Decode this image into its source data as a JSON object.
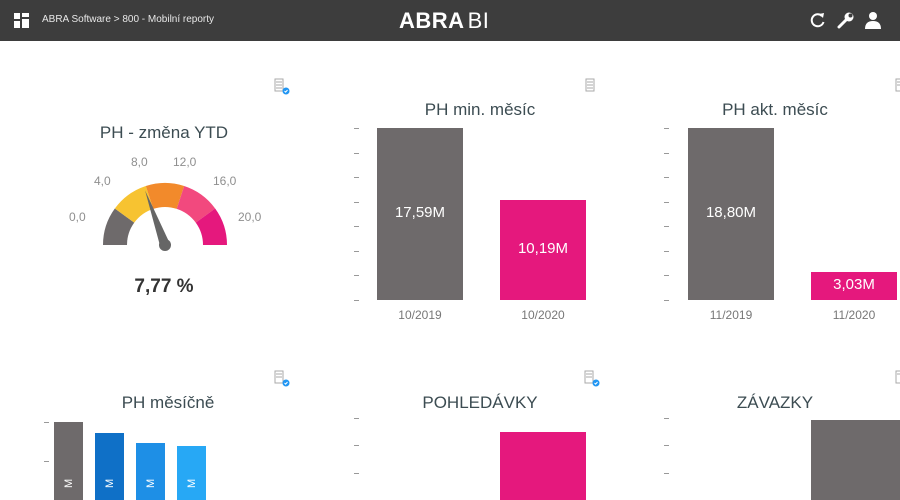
{
  "header": {
    "breadcrumb": "ABRA Software > 800 - Mobilní reporty",
    "brand_bold": "ABRA",
    "brand_light": "BI",
    "icons": [
      "dashboard-grid-icon",
      "refresh-icon",
      "wrench-icon",
      "user-icon"
    ]
  },
  "colors": {
    "topbar": "#3d3d3d",
    "gray_bar": "#6e6a6b",
    "pink_bar": "#e5187d",
    "blue_dark": "#0f70c7",
    "blue_mid": "#1e8fe6",
    "blue_light": "#27a8f5"
  },
  "tiles": {
    "ytd": {
      "title": "PH - změna YTD",
      "value_text": "7,77 %",
      "scale_labels": [
        "0,0",
        "4,0",
        "8,0",
        "12,0",
        "16,0",
        "20,0"
      ]
    },
    "prev_month": {
      "title": "PH min. měsíc"
    },
    "cur_month": {
      "title": "PH akt. měsíc"
    },
    "monthly": {
      "title": "PH měsíčně"
    },
    "receivables": {
      "title": "POHLEDÁVKY"
    },
    "payables": {
      "title": "ZÁVAZKY"
    }
  },
  "chart_data": [
    {
      "type": "gauge",
      "title": "PH - změna YTD",
      "value": 7.77,
      "value_label": "7,77 %",
      "range": [
        0,
        20
      ],
      "tick_labels": [
        "0,0",
        "4,0",
        "8,0",
        "12,0",
        "16,0",
        "20,0"
      ],
      "bands": [
        {
          "from": 0,
          "to": 4,
          "color": "#6e6a6b"
        },
        {
          "from": 4,
          "to": 8,
          "color": "#f7c331"
        },
        {
          "from": 8,
          "to": 12,
          "color": "#f28a2b"
        },
        {
          "from": 12,
          "to": 16,
          "color": "#f2497e"
        },
        {
          "from": 16,
          "to": 20,
          "color": "#e5187d"
        }
      ]
    },
    {
      "type": "bar",
      "title": "PH min. měsíc",
      "categories": [
        "10/2019",
        "10/2020"
      ],
      "values": [
        17.59,
        10.19
      ],
      "value_labels": [
        "17,59M",
        "10,19M"
      ],
      "colors": [
        "#6e6a6b",
        "#e5187d"
      ],
      "ylim": [
        0,
        17.59
      ]
    },
    {
      "type": "bar",
      "title": "PH akt. měsíc",
      "categories": [
        "11/2019",
        "11/2020"
      ],
      "values": [
        18.8,
        3.03
      ],
      "value_labels": [
        "18,80M",
        "3,03M"
      ],
      "colors": [
        "#6e6a6b",
        "#e5187d"
      ],
      "ylim": [
        0,
        20.7
      ]
    },
    {
      "type": "bar",
      "title": "PH měsíčně",
      "values": [
        1.0,
        0.86,
        0.73,
        0.69
      ],
      "value_labels": [
        "M",
        "M",
        "M",
        "M"
      ],
      "colors": [
        "#6e6a6b",
        "#0f70c7",
        "#1e8fe6",
        "#27a8f5"
      ]
    },
    {
      "type": "bar",
      "title": "POHLEDÁVKY",
      "values": [
        1.0
      ],
      "colors": [
        "#e5187d"
      ]
    },
    {
      "type": "bar",
      "title": "ZÁVAZKY",
      "values": [
        1.0
      ],
      "colors": [
        "#6e6a6b"
      ]
    }
  ]
}
